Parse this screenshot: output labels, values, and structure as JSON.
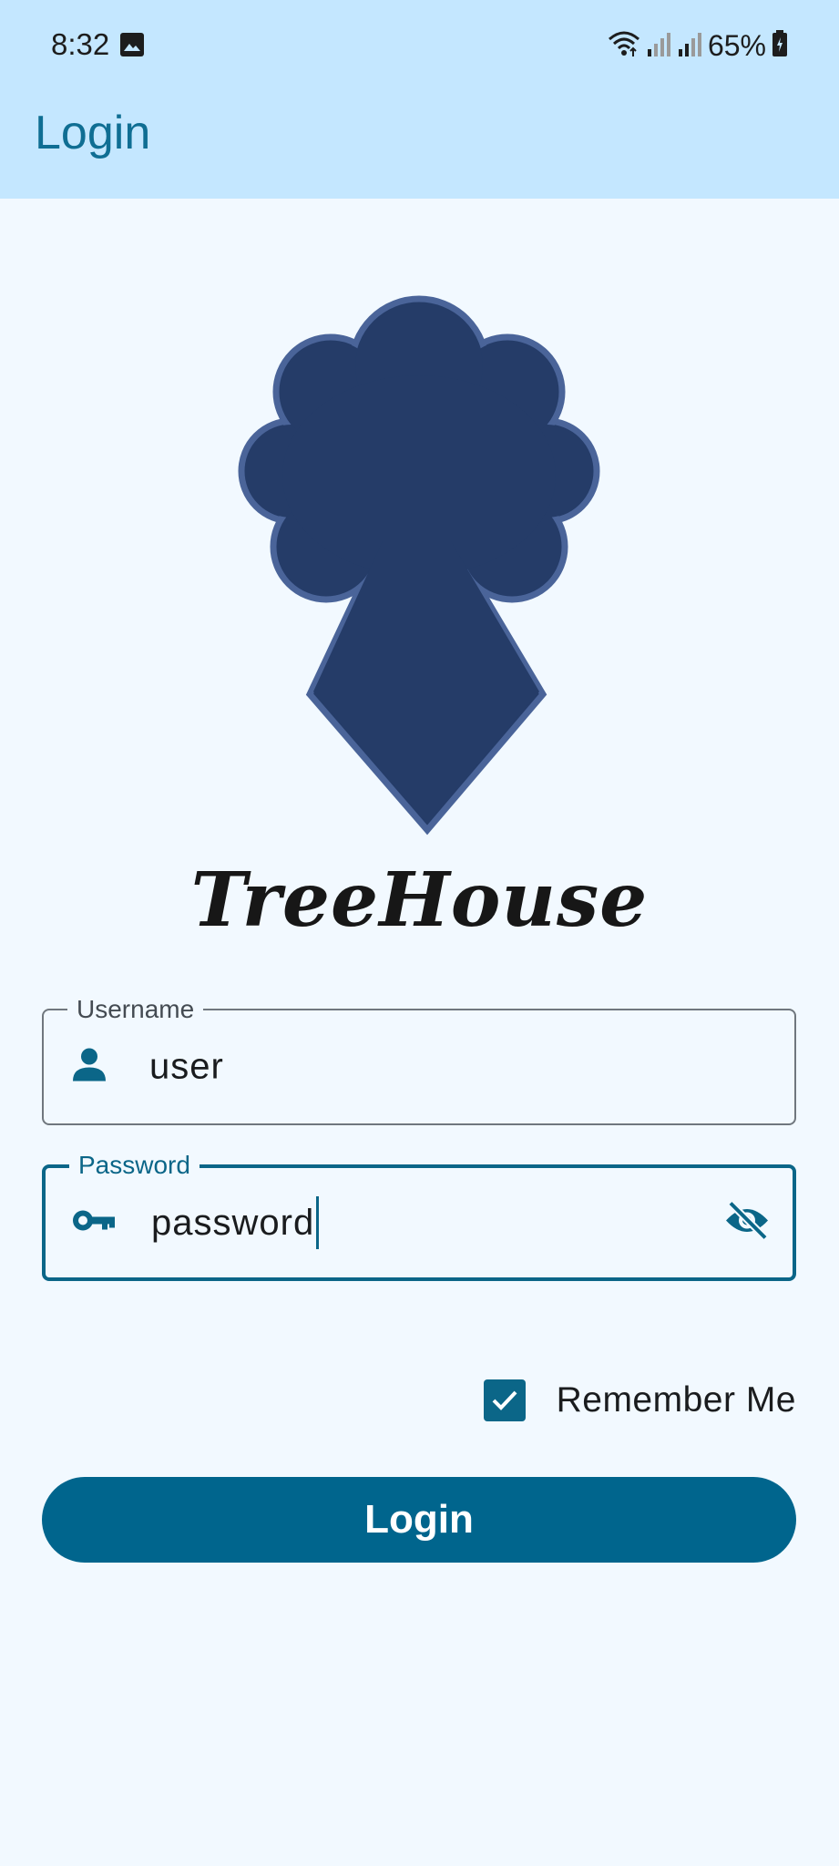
{
  "status_bar": {
    "time": "8:32",
    "battery": "65%",
    "icons": [
      "photo-icon",
      "wifi-icon",
      "signal-icon",
      "signal-icon",
      "battery-charging-icon"
    ]
  },
  "app_bar": {
    "title": "Login"
  },
  "brand": {
    "name": "TreeHouse",
    "logo_icon": "tree-logo-icon"
  },
  "form": {
    "username": {
      "label": "Username",
      "value": "user",
      "icon": "person-icon"
    },
    "password": {
      "label": "Password",
      "value": "password",
      "icon": "key-icon",
      "toggle_icon": "visibility-off-icon"
    },
    "remember": {
      "label": "Remember Me",
      "checked": true
    },
    "submit_label": "Login"
  },
  "colors": {
    "primary": "#00658d",
    "app_bar_bg": "#c4e7ff",
    "background": "#f2f9ff",
    "logo_fill": "#253c68",
    "logo_stroke": "#4a6499"
  }
}
